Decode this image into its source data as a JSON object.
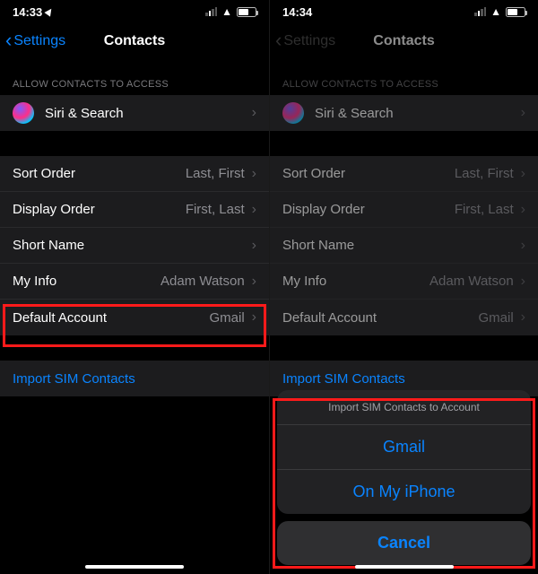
{
  "left": {
    "status": {
      "time": "14:33"
    },
    "nav": {
      "back": "Settings",
      "title": "Contacts"
    },
    "access_header": "ALLOW CONTACTS TO ACCESS",
    "siri_label": "Siri & Search",
    "rows": {
      "sort": {
        "label": "Sort Order",
        "value": "Last, First"
      },
      "display": {
        "label": "Display Order",
        "value": "First, Last"
      },
      "short": {
        "label": "Short Name",
        "value": ""
      },
      "myinfo": {
        "label": "My Info",
        "value": "Adam Watson"
      },
      "default": {
        "label": "Default Account",
        "value": "Gmail"
      }
    },
    "import_label": "Import SIM Contacts"
  },
  "right": {
    "status": {
      "time": "14:34"
    },
    "nav": {
      "back": "Settings",
      "title": "Contacts"
    },
    "access_header": "ALLOW CONTACTS TO ACCESS",
    "siri_label": "Siri & Search",
    "rows": {
      "sort": {
        "label": "Sort Order",
        "value": "Last, First"
      },
      "display": {
        "label": "Display Order",
        "value": "First, Last"
      },
      "short": {
        "label": "Short Name",
        "value": ""
      },
      "myinfo": {
        "label": "My Info",
        "value": "Adam Watson"
      },
      "default": {
        "label": "Default Account",
        "value": "Gmail"
      }
    },
    "import_label": "Import SIM Contacts",
    "sheet": {
      "header": "Import SIM Contacts to Account",
      "opt1": "Gmail",
      "opt2": "On My iPhone",
      "cancel": "Cancel"
    }
  }
}
